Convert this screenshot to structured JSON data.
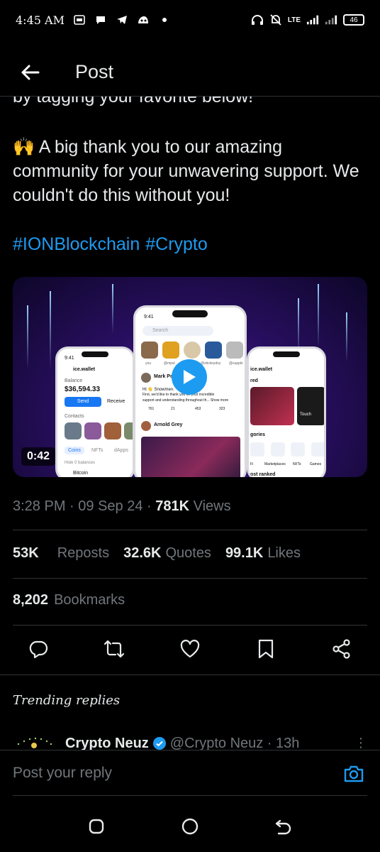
{
  "status_bar": {
    "time": "4:45 AM",
    "network": "LTE",
    "battery": "46"
  },
  "header": {
    "title": "Post"
  },
  "post": {
    "cut_text": "by tagging your favorite below!",
    "body_emoji": "🙌",
    "body_text": "A big thank you to our amazing community for your unwavering support. We couldn't do this without you!",
    "hashtags": [
      "#IONBlockchain",
      "#Crypto"
    ],
    "media": {
      "duration": "0:42",
      "left_phone": {
        "time": "9:41",
        "app": "ice.wallet",
        "balance_label": "Balance",
        "balance": "$36,594.33",
        "send": "Send",
        "receive": "Receive",
        "contacts": "Contacts",
        "coins": "Coins",
        "nfts": "NFTs",
        "dapps": "dApps",
        "hide_balances": "Hide 0 balances",
        "bitcoin": "Bitcoin"
      },
      "center_phone": {
        "time": "9:41",
        "search": "Search",
        "story_names": [
          "you",
          "@mpsl",
          "",
          "@stickeydoy",
          "@supple"
        ],
        "post1_name": "Mark Po",
        "post1_line1": "Hi 👋 Snowmen.",
        "post1_line2": "First, we'd like to thank you for your incredible",
        "post1_line3": "support and understanding throughout th... Show more",
        "post1_stats": [
          "761",
          "21",
          "453",
          "323"
        ],
        "post2_name": "Arnold Grey"
      },
      "right_phone": {
        "app": "ice.wallet",
        "red": "red",
        "touch": "Touch",
        "categories": "gories",
        "cat_items": [
          "Fi",
          "Marketplaces",
          "NFTs",
          "Games"
        ],
        "most_ranked": "ost ranked"
      }
    },
    "meta": {
      "time": "3:28 PM",
      "date": "09 Sep 24",
      "views_count": "781K",
      "views_label": "Views"
    },
    "stats": {
      "reposts_count": "53K",
      "reposts_label": "Reposts",
      "quotes_count": "32.6K",
      "quotes_label": "Quotes",
      "likes_count": "99.1K",
      "likes_label": "Likes",
      "bookmarks_count": "8,202",
      "bookmarks_label": "Bookmarks"
    }
  },
  "trending": {
    "label": "Trending replies",
    "reply_name": "Crypto Neuz",
    "reply_handle": "@Crypto Neuz · 13h"
  },
  "reply_box": {
    "placeholder": "Post your reply"
  },
  "colors": {
    "accent": "#1d9bf0",
    "muted": "#71767b",
    "text": "#e7e9ea",
    "background": "#000000"
  },
  "icons": [
    "back-arrow-icon",
    "reply-icon",
    "repost-icon",
    "like-icon",
    "bookmark-icon",
    "share-icon",
    "camera-icon",
    "verified-icon",
    "play-icon",
    "recents-icon",
    "home-icon",
    "back-nav-icon"
  ]
}
